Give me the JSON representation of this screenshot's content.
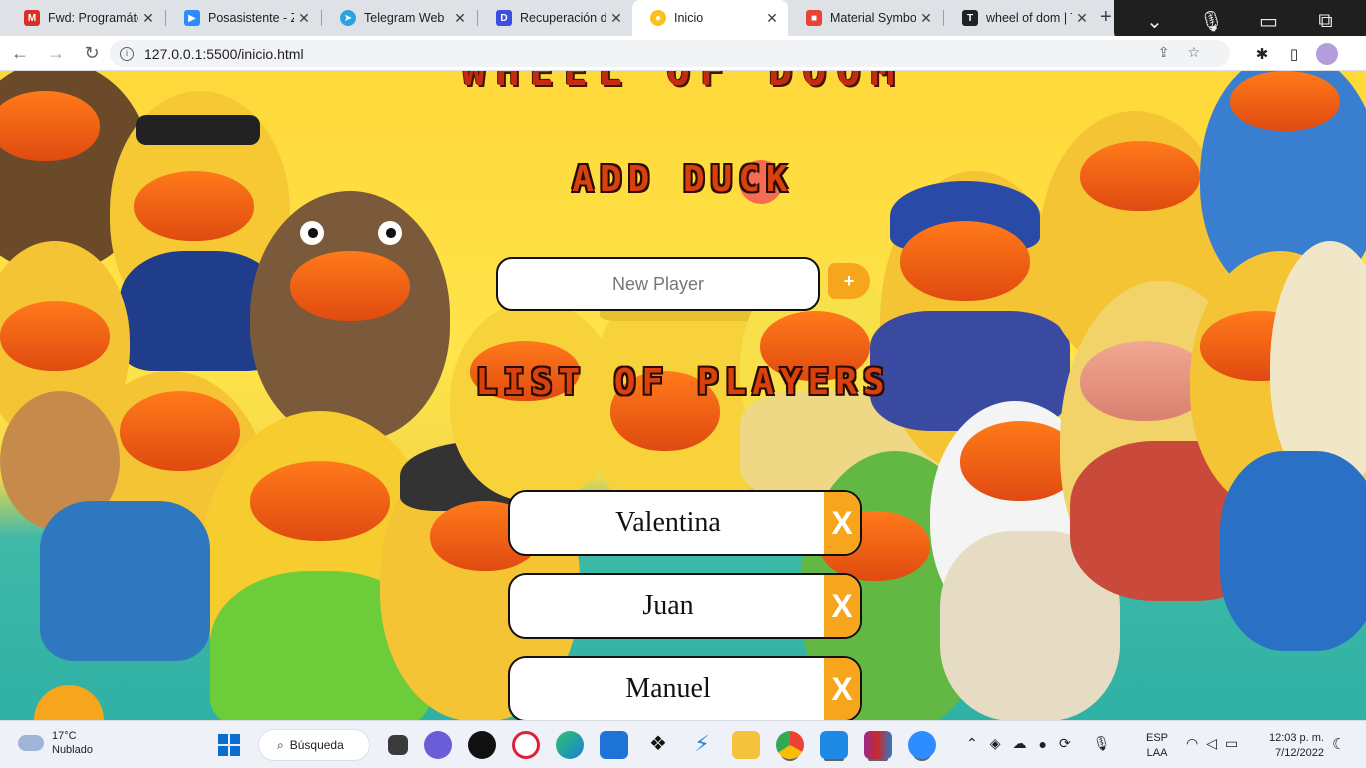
{
  "browser": {
    "tabs": [
      {
        "title": "Fwd: Programáte",
        "favicon": "gmail-icon",
        "color": "#d93025",
        "glyph": "M"
      },
      {
        "title": "Posasistente - Zo",
        "favicon": "zoom-icon",
        "color": "#2d8cff",
        "glyph": "▶"
      },
      {
        "title": "Telegram Web",
        "favicon": "telegram-icon",
        "color": "#2aa3e0",
        "glyph": "➤"
      },
      {
        "title": "Recuperación de",
        "favicon": "platform-icon",
        "color": "#3b4fe0",
        "glyph": "D"
      },
      {
        "title": "Inicio",
        "favicon": "duck-icon",
        "color": "#f7c21c",
        "glyph": "●"
      },
      {
        "title": "Material Symbols",
        "favicon": "material-icon",
        "color": "#ea4335",
        "glyph": "■"
      },
      {
        "title": "wheel of dom | Tr",
        "favicon": "trello-icon",
        "color": "#202124",
        "glyph": "T"
      }
    ],
    "active_tab": 4,
    "new_tab_label": "+",
    "address": "127.0.0.1:5500/inicio.html"
  },
  "page": {
    "top_title": "WHEEL OF DOOM",
    "add_section_title": "ADD DUCK",
    "input_placeholder": "New Player",
    "add_button_label": "+",
    "list_section_title": "LIST OF PLAYERS",
    "players": [
      "Valentina",
      "Juan",
      "Manuel"
    ],
    "remove_label": "X",
    "accent_color": "#f7a51c",
    "title_color": "#d8400e"
  },
  "taskbar": {
    "weather_temp": "17°C",
    "weather_desc": "Nublado",
    "search_label": "Búsqueda",
    "lang_line1": "ESP",
    "lang_line2": "LAA",
    "time": "12:03 p. m.",
    "date": "7/12/2022"
  }
}
